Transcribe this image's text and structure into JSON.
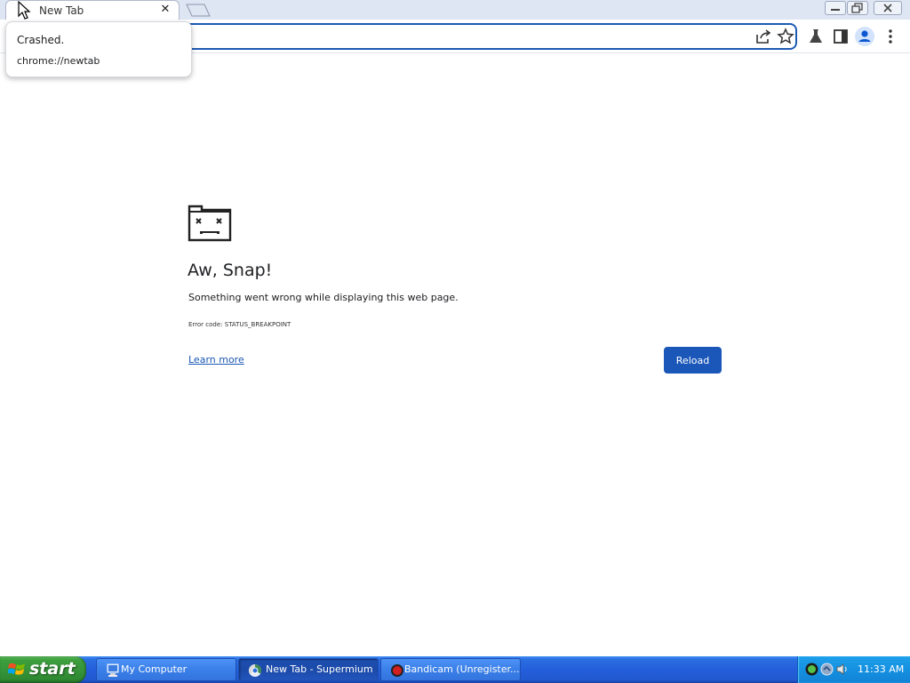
{
  "browser": {
    "tab": {
      "title": "New Tab",
      "close_glyph": "✕"
    },
    "popup": {
      "status": "Crashed.",
      "url": "chrome://newtab"
    }
  },
  "error_page": {
    "heading": "Aw, Snap!",
    "message": "Something went wrong while displaying this web page.",
    "error_code": "Error code: STATUS_BREAKPOINT",
    "learn_more": "Learn more",
    "reload": "Reload"
  },
  "taskbar": {
    "start": "start",
    "tasks": [
      {
        "label": "My Computer",
        "icon": "my-computer-icon"
      },
      {
        "label": "New Tab - Supermium",
        "icon": "browser-icon"
      },
      {
        "label": "Bandicam (Unregister...",
        "icon": "bandicam-icon"
      }
    ],
    "clock": "11:33 AM"
  },
  "colors": {
    "accent": "#1a57b9",
    "link": "#1a57b4",
    "taskbar": "#245edb",
    "start_button": "#37953a",
    "tray": "#1590e0"
  }
}
